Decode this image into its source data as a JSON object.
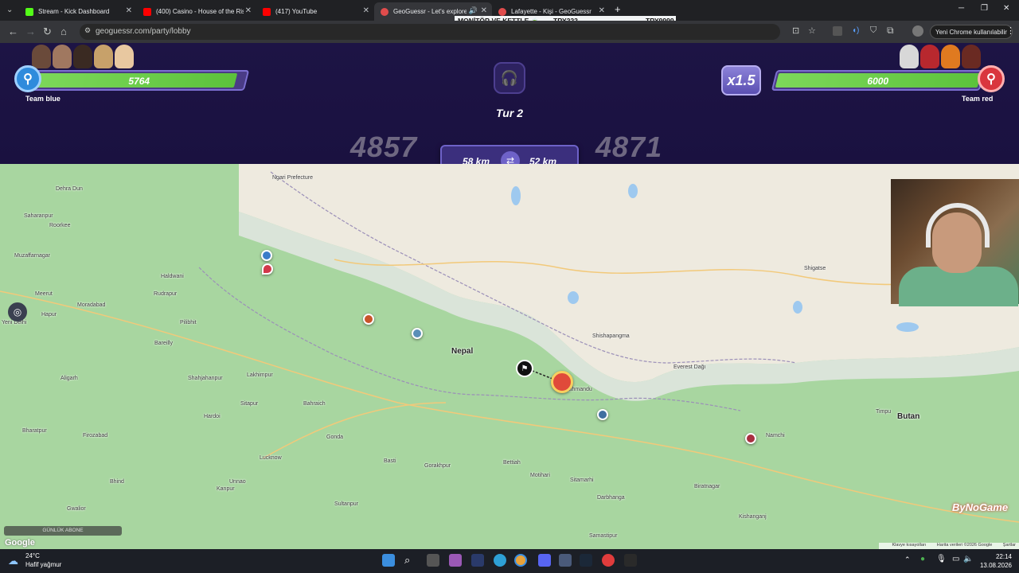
{
  "browser": {
    "tabs": [
      {
        "title": "Stream - Kick Dashboard",
        "favicon_color": "#53fc18",
        "active": false
      },
      {
        "title": "(400) Casino - House of the Ris",
        "favicon_color": "#ff0000",
        "active": false
      },
      {
        "title": "(417) YouTube",
        "favicon_color": "#ff0000",
        "active": false
      },
      {
        "title": "GeoGuessr - Let's explore th",
        "favicon_color": "#e04c4c",
        "active": true
      },
      {
        "title": "Lafayette - Kişi - GeoGuessr",
        "favicon_color": "#e04c4c",
        "active": false
      }
    ],
    "new_tab_label": "+",
    "url": "geoguessr.com/party/lobby",
    "chrome_update_label": "Yeni Chrome kullanılabilir",
    "price_bar": {
      "item_label": "MONİTÖR VE KETTLE 🍵",
      "price_1": "TRY222",
      "price_2": "TRY9999"
    }
  },
  "game": {
    "team_blue": {
      "name": "Team blue",
      "score": "5764",
      "fill_fraction": 0.9607,
      "color": "#2f8bdc"
    },
    "team_red": {
      "name": "Team red",
      "score": "6000",
      "fill_fraction": 1.0,
      "color": "#d9363e"
    },
    "multiplier": "x1.5",
    "round_label": "Tur 2",
    "round_score_blue": "4857",
    "round_score_red": "4871",
    "distance_blue": "58 km",
    "distance_red": "52 km"
  },
  "map": {
    "places": [
      {
        "name": "Dehra Dun",
        "kind": "city"
      },
      {
        "name": "Saharanpur",
        "kind": "city"
      },
      {
        "name": "Roorkee",
        "kind": "city"
      },
      {
        "name": "Muzaffarnagar",
        "kind": "city"
      },
      {
        "name": "Haldwani",
        "kind": "city"
      },
      {
        "name": "Meerut",
        "kind": "city"
      },
      {
        "name": "Moradabad",
        "kind": "city"
      },
      {
        "name": "Rudrapur",
        "kind": "city"
      },
      {
        "name": "Yeni Delhi",
        "kind": "city"
      },
      {
        "name": "Hapur",
        "kind": "city"
      },
      {
        "name": "Pilibhit",
        "kind": "city"
      },
      {
        "name": "Bareilly",
        "kind": "city"
      },
      {
        "name": "Lakhimpur",
        "kind": "city"
      },
      {
        "name": "Shahjahanpur",
        "kind": "city"
      },
      {
        "name": "Aligarh",
        "kind": "city"
      },
      {
        "name": "Sitapur",
        "kind": "city"
      },
      {
        "name": "Hardoi",
        "kind": "city"
      },
      {
        "name": "Bahraich",
        "kind": "city"
      },
      {
        "name": "Gonda",
        "kind": "city"
      },
      {
        "name": "Bharatpur",
        "kind": "city"
      },
      {
        "name": "Firozabad",
        "kind": "city"
      },
      {
        "name": "Lucknow",
        "kind": "city"
      },
      {
        "name": "Basti",
        "kind": "city"
      },
      {
        "name": "Gorakhpur",
        "kind": "city"
      },
      {
        "name": "Kanpur",
        "kind": "city"
      },
      {
        "name": "Unnao",
        "kind": "city"
      },
      {
        "name": "Sultanpur",
        "kind": "city"
      },
      {
        "name": "Bettiah",
        "kind": "city"
      },
      {
        "name": "Motihari",
        "kind": "city"
      },
      {
        "name": "Sitamarhi",
        "kind": "city"
      },
      {
        "name": "Darbhanga",
        "kind": "city"
      },
      {
        "name": "Samastipur",
        "kind": "city"
      },
      {
        "name": "Biratnagar",
        "kind": "city"
      },
      {
        "name": "Kishanganj",
        "kind": "city"
      },
      {
        "name": "Gwalior",
        "kind": "city"
      },
      {
        "name": "Bhind",
        "kind": "city"
      },
      {
        "name": "Nepal",
        "kind": "country"
      },
      {
        "name": "Butan",
        "kind": "country"
      },
      {
        "name": "Ngari Prefecture",
        "kind": "city"
      },
      {
        "name": "Shigatse",
        "kind": "city"
      },
      {
        "name": "Shishapangma",
        "kind": "poi"
      },
      {
        "name": "Everest Dağı",
        "kind": "poi"
      },
      {
        "name": "Timpu",
        "kind": "city"
      },
      {
        "name": "Namchi",
        "kind": "city"
      },
      {
        "name": "Kathmandu",
        "kind": "city"
      }
    ],
    "subscriber_widget": "GÜNLÜK ABONE",
    "watermark": "ByNoGame",
    "google_logo": "Google",
    "attribution": {
      "shortcuts": "Klavye kısayolları",
      "data": "Harita verileri ©2026 Google",
      "terms": "Şartlar"
    }
  },
  "taskbar": {
    "weather_temp": "24°C",
    "weather_desc": "Hafif yağmur",
    "time": "22:14",
    "date": "13.08.2026"
  }
}
